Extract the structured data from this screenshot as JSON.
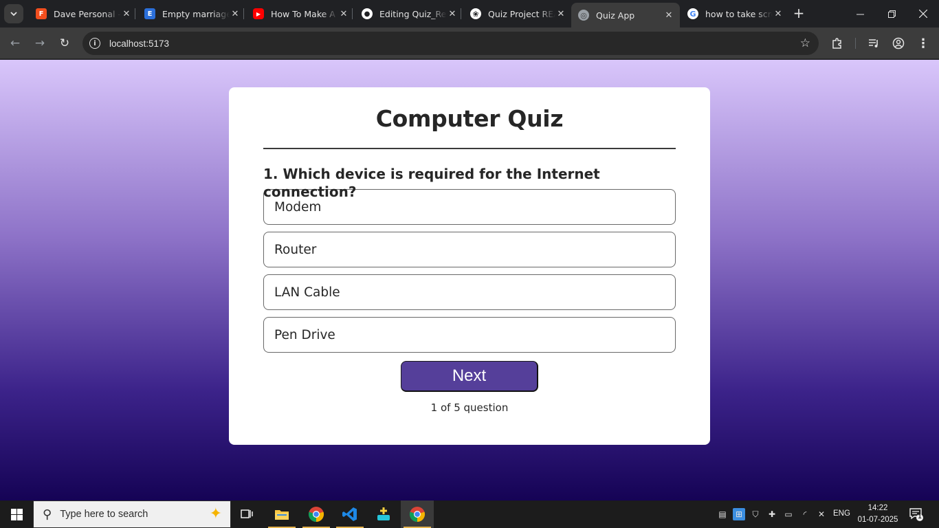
{
  "browser": {
    "tabs": [
      {
        "title": "Dave Personal –",
        "favicon": "figma-icon",
        "color": "#f24e1e",
        "glyph": "F"
      },
      {
        "title": "Empty marriage",
        "favicon": "document-icon",
        "color": "#2b6fda",
        "glyph": "E"
      },
      {
        "title": "How To Make A",
        "favicon": "youtube-icon",
        "color": "#ff0000",
        "glyph": "▶"
      },
      {
        "title": "Editing Quiz_Rea",
        "favicon": "github-icon",
        "color": "#ffffff",
        "glyph": "●"
      },
      {
        "title": "Quiz Project REA",
        "favicon": "chatgpt-icon",
        "color": "#ffffff",
        "glyph": "❀"
      },
      {
        "title": "Quiz App",
        "favicon": "globe-icon",
        "color": "#9aa0a6",
        "glyph": "◎",
        "active": true
      },
      {
        "title": "how to take scre",
        "favicon": "google-icon",
        "color": "#ffffff",
        "glyph": "G"
      }
    ],
    "url": "localhost:5173"
  },
  "quiz": {
    "title": "Computer Quiz",
    "question": "1. Which device is required for the Internet connection?",
    "options": [
      "Modem",
      "Router",
      "LAN Cable",
      "Pen Drive"
    ],
    "next_label": "Next",
    "progress": "1 of 5 question"
  },
  "taskbar": {
    "search_placeholder": "Type here to search",
    "language": "ENG",
    "time": "14:22",
    "date": "01-07-2025",
    "notification_count": "1"
  },
  "colors": {
    "accent": "#553f9a",
    "gradient_top": "#d9c6fb",
    "gradient_bottom": "#150355"
  }
}
